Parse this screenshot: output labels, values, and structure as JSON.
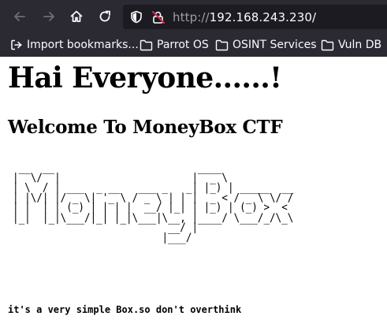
{
  "browser": {
    "url_protocol": "http://",
    "url_host": "192.168.243.230/"
  },
  "bookmarks": [
    {
      "label": "Import bookmarks..."
    },
    {
      "label": "Parrot OS"
    },
    {
      "label": "OSINT Services"
    },
    {
      "label": "Vuln DB"
    }
  ],
  "page": {
    "heading": "Hai Everyone......!",
    "subheading": "Welcome To MoneyBox CTF",
    "ascii_art": " __  __                        ____             \n|  \\/  |                      |  _ \\            \n| \\  / | ___  _ __   ___ _   _| |_) | _____  __ \n| |\\/| |/ _ \\| '_ \\ / _ \\ | | |  _ < / _ \\ \\/ / \n| |  | | (_) | | | |  __/ |_| | |_) | (_) >  <  \n|_|  |_|\\___/|_| |_|\\___|\\__, |____/ \\___/_/\\_\\ \n                          __/ |                 \n                         |___/                  ",
    "footer": "it's a very simple Box.so don't overthink"
  }
}
